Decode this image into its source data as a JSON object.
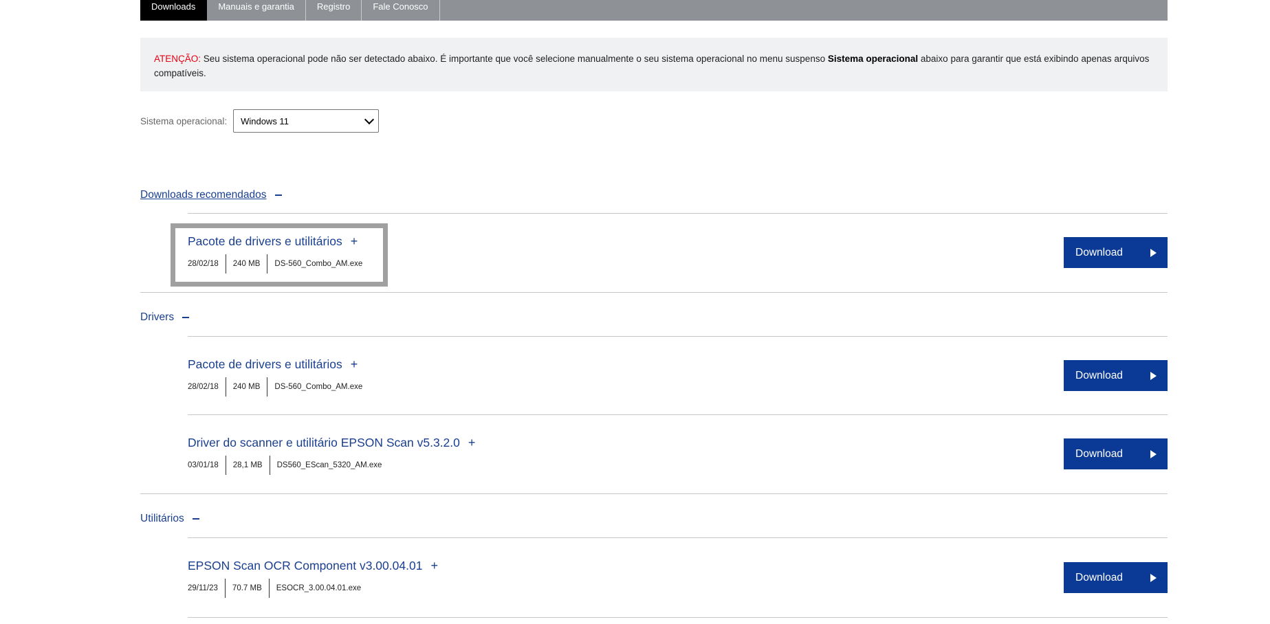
{
  "tabs": [
    {
      "label": "Downloads",
      "active": true
    },
    {
      "label": "Manuais e garantia",
      "active": false
    },
    {
      "label": "Registro",
      "active": false
    },
    {
      "label": "Fale Conosco",
      "active": false
    }
  ],
  "alert": {
    "prefix": "ATENÇÃO:",
    "text_before": " Seu sistema operacional pode não ser detectado abaixo. É importante que você selecione manualmente o seu sistema operacional no menu suspenso ",
    "bold": "Sistema operacional",
    "text_after": " abaixo para garantir que está exibindo apenas arquivos compatíveis."
  },
  "os": {
    "label": "Sistema operacional:",
    "selected": "Windows 11"
  },
  "sections": {
    "recommended": {
      "title": "Downloads recomendados"
    },
    "drivers": {
      "title": "Drivers"
    },
    "utilities": {
      "title": "Utilitários"
    }
  },
  "items": [
    {
      "title": "Pacote de drivers e utilitários",
      "date": "28/02/18",
      "size": "240 MB",
      "file": "DS-560_Combo_AM.exe",
      "button": "Download"
    },
    {
      "title": "Pacote de drivers e utilitários",
      "date": "28/02/18",
      "size": "240 MB",
      "file": "DS-560_Combo_AM.exe",
      "button": "Download"
    },
    {
      "title": "Driver do scanner e utilitário EPSON Scan v5.3.2.0",
      "date": "03/01/18",
      "size": "28,1 MB",
      "file": "DS560_EScan_5320_AM.exe",
      "button": "Download"
    },
    {
      "title": "EPSON Scan OCR Component v3.00.04.01",
      "date": "29/11/23",
      "size": "70.7 MB",
      "file": "ESOCR_3.00.04.01.exe",
      "button": "Download"
    }
  ],
  "colors": {
    "accent": "#0b3a96",
    "link": "#1a3f8f",
    "warning": "#e60012",
    "tabbar": "#8e9196"
  }
}
